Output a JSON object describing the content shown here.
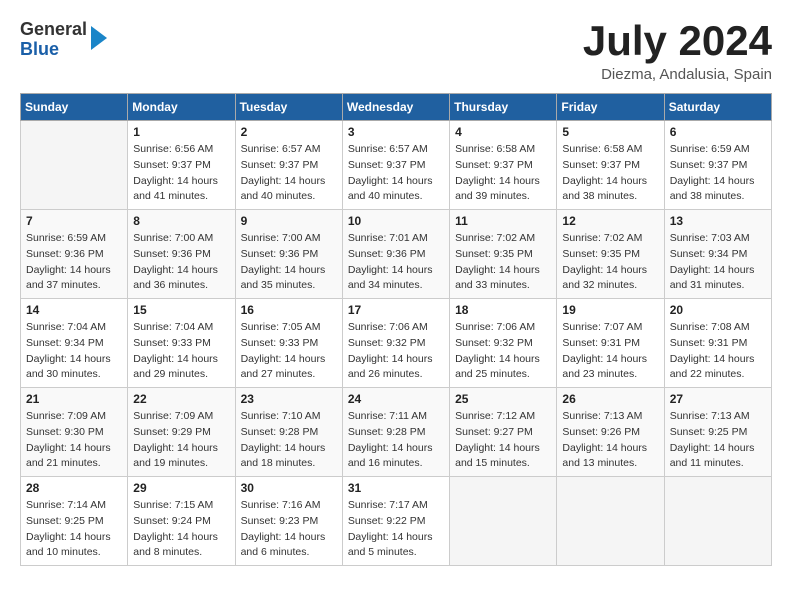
{
  "header": {
    "logo_line1": "General",
    "logo_line2": "Blue",
    "month_title": "July 2024",
    "location": "Diezma, Andalusia, Spain"
  },
  "days_of_week": [
    "Sunday",
    "Monday",
    "Tuesday",
    "Wednesday",
    "Thursday",
    "Friday",
    "Saturday"
  ],
  "weeks": [
    [
      {
        "num": "",
        "info": ""
      },
      {
        "num": "1",
        "info": "Sunrise: 6:56 AM\nSunset: 9:37 PM\nDaylight: 14 hours\nand 41 minutes."
      },
      {
        "num": "2",
        "info": "Sunrise: 6:57 AM\nSunset: 9:37 PM\nDaylight: 14 hours\nand 40 minutes."
      },
      {
        "num": "3",
        "info": "Sunrise: 6:57 AM\nSunset: 9:37 PM\nDaylight: 14 hours\nand 40 minutes."
      },
      {
        "num": "4",
        "info": "Sunrise: 6:58 AM\nSunset: 9:37 PM\nDaylight: 14 hours\nand 39 minutes."
      },
      {
        "num": "5",
        "info": "Sunrise: 6:58 AM\nSunset: 9:37 PM\nDaylight: 14 hours\nand 38 minutes."
      },
      {
        "num": "6",
        "info": "Sunrise: 6:59 AM\nSunset: 9:37 PM\nDaylight: 14 hours\nand 38 minutes."
      }
    ],
    [
      {
        "num": "7",
        "info": "Sunrise: 6:59 AM\nSunset: 9:36 PM\nDaylight: 14 hours\nand 37 minutes."
      },
      {
        "num": "8",
        "info": "Sunrise: 7:00 AM\nSunset: 9:36 PM\nDaylight: 14 hours\nand 36 minutes."
      },
      {
        "num": "9",
        "info": "Sunrise: 7:00 AM\nSunset: 9:36 PM\nDaylight: 14 hours\nand 35 minutes."
      },
      {
        "num": "10",
        "info": "Sunrise: 7:01 AM\nSunset: 9:36 PM\nDaylight: 14 hours\nand 34 minutes."
      },
      {
        "num": "11",
        "info": "Sunrise: 7:02 AM\nSunset: 9:35 PM\nDaylight: 14 hours\nand 33 minutes."
      },
      {
        "num": "12",
        "info": "Sunrise: 7:02 AM\nSunset: 9:35 PM\nDaylight: 14 hours\nand 32 minutes."
      },
      {
        "num": "13",
        "info": "Sunrise: 7:03 AM\nSunset: 9:34 PM\nDaylight: 14 hours\nand 31 minutes."
      }
    ],
    [
      {
        "num": "14",
        "info": "Sunrise: 7:04 AM\nSunset: 9:34 PM\nDaylight: 14 hours\nand 30 minutes."
      },
      {
        "num": "15",
        "info": "Sunrise: 7:04 AM\nSunset: 9:33 PM\nDaylight: 14 hours\nand 29 minutes."
      },
      {
        "num": "16",
        "info": "Sunrise: 7:05 AM\nSunset: 9:33 PM\nDaylight: 14 hours\nand 27 minutes."
      },
      {
        "num": "17",
        "info": "Sunrise: 7:06 AM\nSunset: 9:32 PM\nDaylight: 14 hours\nand 26 minutes."
      },
      {
        "num": "18",
        "info": "Sunrise: 7:06 AM\nSunset: 9:32 PM\nDaylight: 14 hours\nand 25 minutes."
      },
      {
        "num": "19",
        "info": "Sunrise: 7:07 AM\nSunset: 9:31 PM\nDaylight: 14 hours\nand 23 minutes."
      },
      {
        "num": "20",
        "info": "Sunrise: 7:08 AM\nSunset: 9:31 PM\nDaylight: 14 hours\nand 22 minutes."
      }
    ],
    [
      {
        "num": "21",
        "info": "Sunrise: 7:09 AM\nSunset: 9:30 PM\nDaylight: 14 hours\nand 21 minutes."
      },
      {
        "num": "22",
        "info": "Sunrise: 7:09 AM\nSunset: 9:29 PM\nDaylight: 14 hours\nand 19 minutes."
      },
      {
        "num": "23",
        "info": "Sunrise: 7:10 AM\nSunset: 9:28 PM\nDaylight: 14 hours\nand 18 minutes."
      },
      {
        "num": "24",
        "info": "Sunrise: 7:11 AM\nSunset: 9:28 PM\nDaylight: 14 hours\nand 16 minutes."
      },
      {
        "num": "25",
        "info": "Sunrise: 7:12 AM\nSunset: 9:27 PM\nDaylight: 14 hours\nand 15 minutes."
      },
      {
        "num": "26",
        "info": "Sunrise: 7:13 AM\nSunset: 9:26 PM\nDaylight: 14 hours\nand 13 minutes."
      },
      {
        "num": "27",
        "info": "Sunrise: 7:13 AM\nSunset: 9:25 PM\nDaylight: 14 hours\nand 11 minutes."
      }
    ],
    [
      {
        "num": "28",
        "info": "Sunrise: 7:14 AM\nSunset: 9:25 PM\nDaylight: 14 hours\nand 10 minutes."
      },
      {
        "num": "29",
        "info": "Sunrise: 7:15 AM\nSunset: 9:24 PM\nDaylight: 14 hours\nand 8 minutes."
      },
      {
        "num": "30",
        "info": "Sunrise: 7:16 AM\nSunset: 9:23 PM\nDaylight: 14 hours\nand 6 minutes."
      },
      {
        "num": "31",
        "info": "Sunrise: 7:17 AM\nSunset: 9:22 PM\nDaylight: 14 hours\nand 5 minutes."
      },
      {
        "num": "",
        "info": ""
      },
      {
        "num": "",
        "info": ""
      },
      {
        "num": "",
        "info": ""
      }
    ]
  ]
}
